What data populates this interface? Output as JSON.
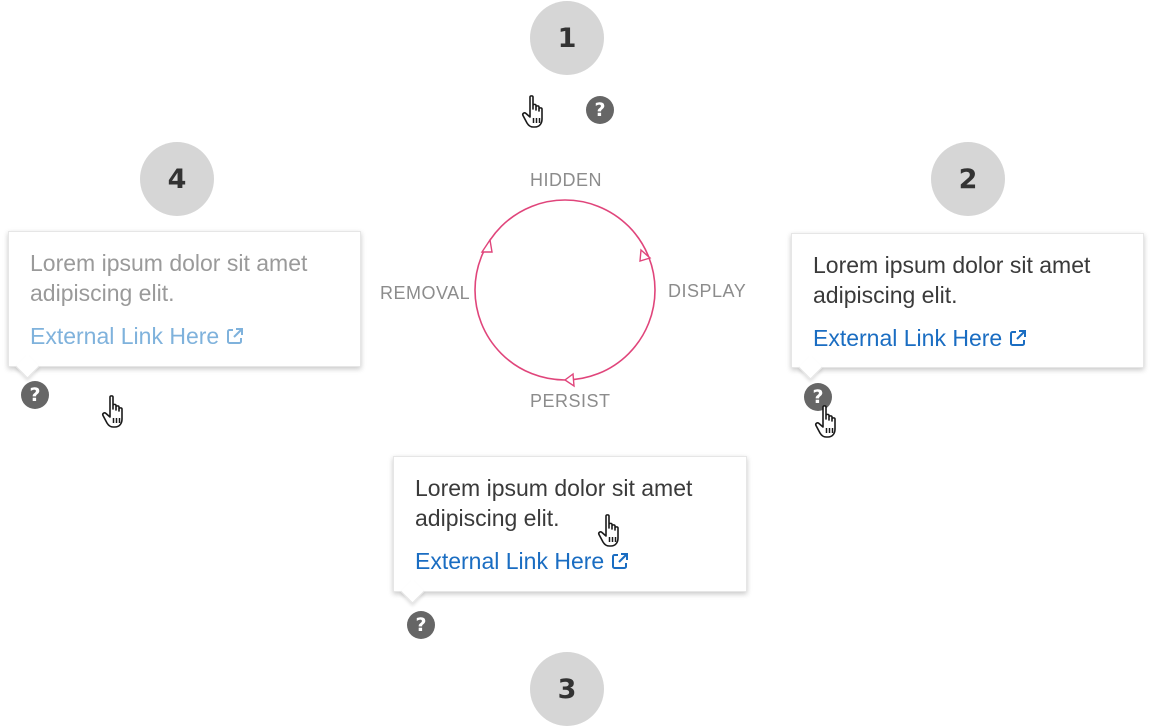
{
  "steps": [
    "1",
    "2",
    "3",
    "4"
  ],
  "help_glyph": "?",
  "icons": {
    "help": "question-circle-icon",
    "pointer": "hand-pointer-icon",
    "external": "external-link-icon"
  },
  "cycle": {
    "labels": {
      "top": "HIDDEN",
      "right": "DISPLAY",
      "bottom": "PERSIST",
      "left": "REMOVAL"
    },
    "color": "#e0457b"
  },
  "tooltips": {
    "step2": {
      "body": "Lorem ipsum dolor sit amet adipiscing elit.",
      "link": "External Link Here"
    },
    "step3": {
      "body": "Lorem ipsum dolor sit amet adipiscing elit.",
      "link": "External Link Here"
    },
    "step4": {
      "body": "Lorem ipsum dolor sit amet adipiscing elit.",
      "link": "External Link Here"
    }
  },
  "colors": {
    "step_badge": "#d6d6d6",
    "help_icon": "#666666",
    "link": "#1a6dc2",
    "link_faded": "#7fb2dc",
    "text": "#3a3a3a",
    "text_faded": "#9a9a9a"
  }
}
